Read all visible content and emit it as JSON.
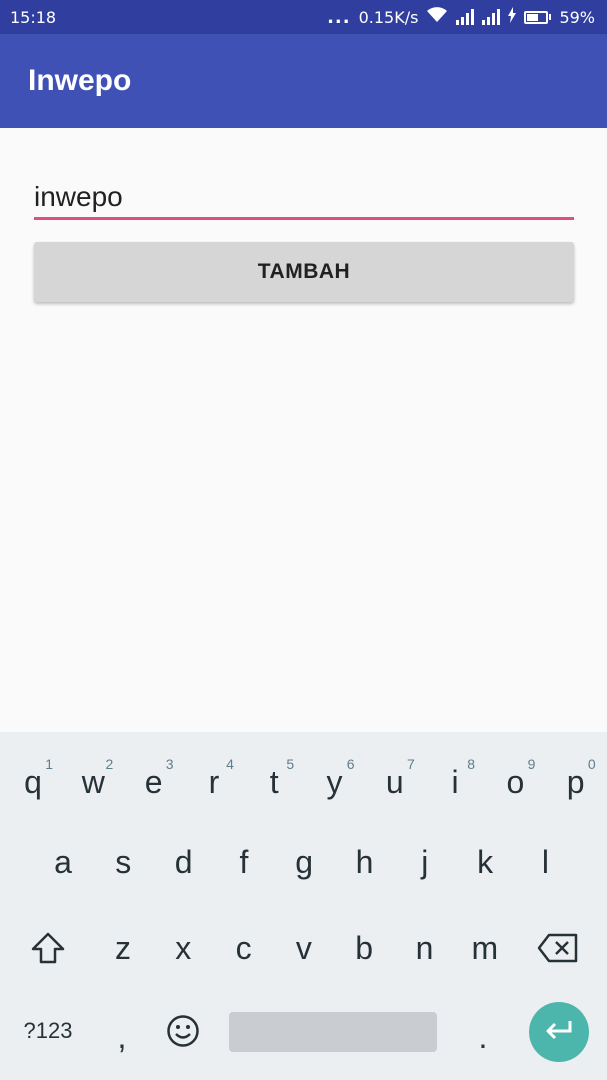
{
  "status_bar": {
    "time": "15:18",
    "dots": "...",
    "net_speed": "0.15K/s",
    "battery": "59%",
    "battery_level": 0.59,
    "icons": [
      "wifi-icon",
      "signal-icon",
      "signal-icon",
      "charging-icon",
      "battery-icon"
    ]
  },
  "app_bar": {
    "title": "Inwepo",
    "color": "#3f51b5"
  },
  "form": {
    "input_value": "inwepo",
    "button_label": "TAMBAH",
    "accent_color": "#e0507e"
  },
  "keyboard": {
    "row1": [
      {
        "key": "q",
        "hint": "1"
      },
      {
        "key": "w",
        "hint": "2"
      },
      {
        "key": "e",
        "hint": "3"
      },
      {
        "key": "r",
        "hint": "4"
      },
      {
        "key": "t",
        "hint": "5"
      },
      {
        "key": "y",
        "hint": "6"
      },
      {
        "key": "u",
        "hint": "7"
      },
      {
        "key": "i",
        "hint": "8"
      },
      {
        "key": "o",
        "hint": "9"
      },
      {
        "key": "p",
        "hint": "0"
      }
    ],
    "row2": [
      "a",
      "s",
      "d",
      "f",
      "g",
      "h",
      "j",
      "k",
      "l"
    ],
    "row3": [
      "z",
      "x",
      "c",
      "v",
      "b",
      "n",
      "m"
    ],
    "symbols_label": "?123",
    "comma": ",",
    "period": ".",
    "icons": [
      "shift-icon",
      "backspace-icon",
      "emoji-icon",
      "enter-icon"
    ],
    "enter_color": "#4db6ac"
  }
}
